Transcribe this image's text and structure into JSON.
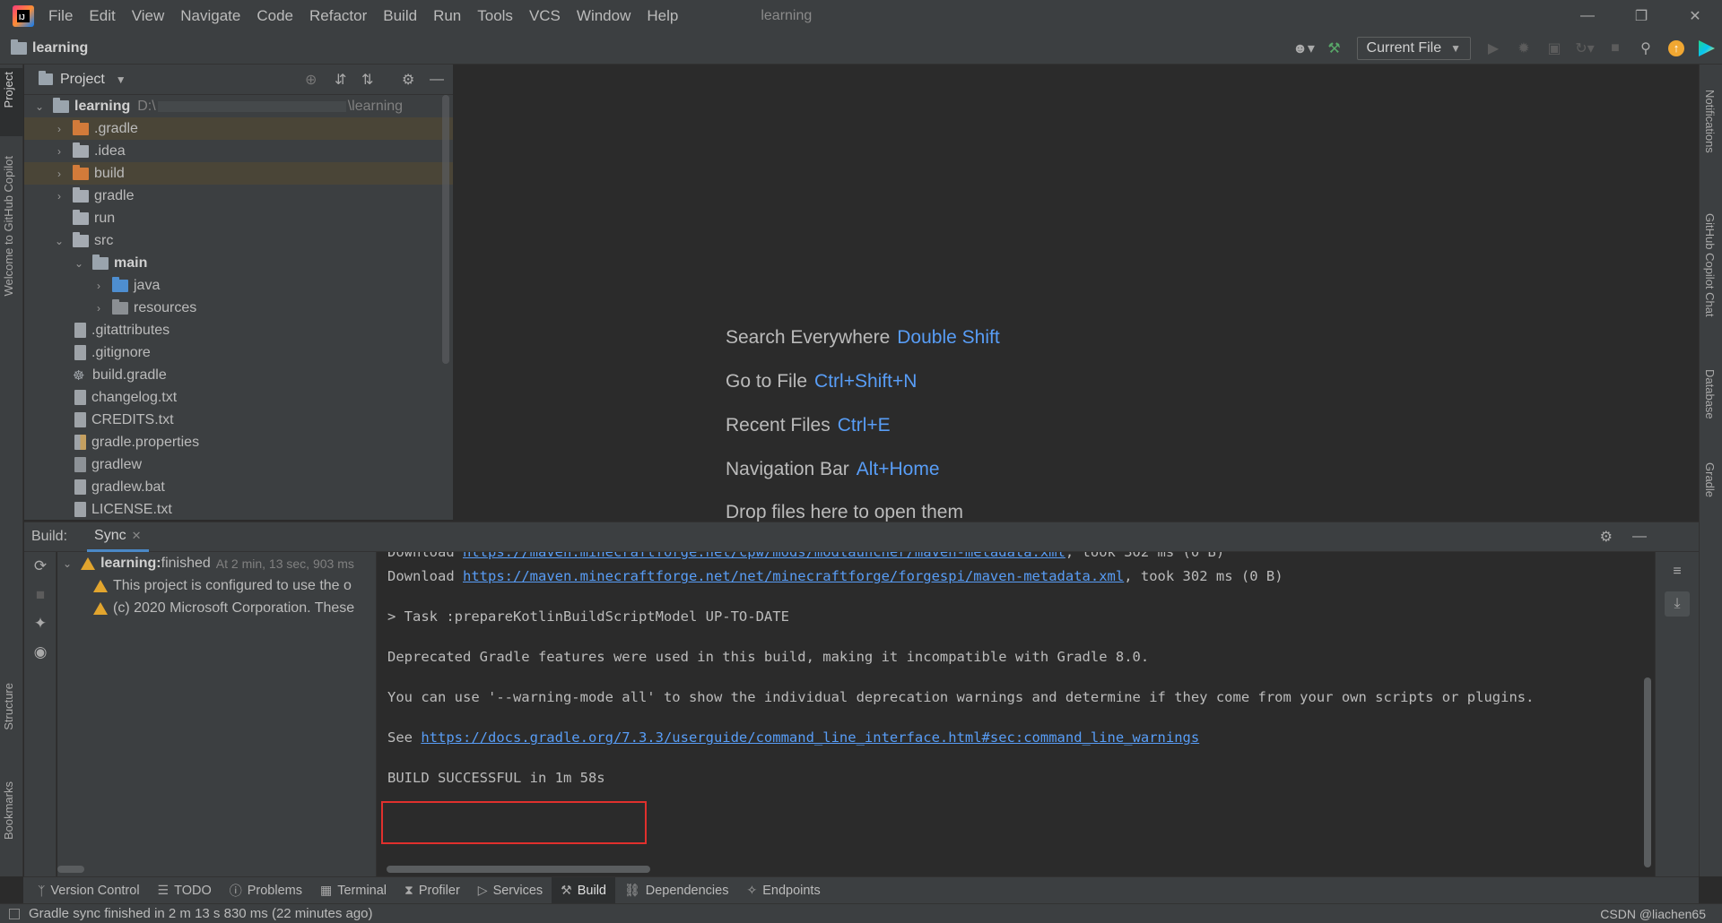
{
  "app": {
    "window_title": "learning",
    "project_name": "learning"
  },
  "menu": [
    "File",
    "Edit",
    "View",
    "Navigate",
    "Code",
    "Refactor",
    "Build",
    "Run",
    "Tools",
    "VCS",
    "Window",
    "Help"
  ],
  "toolbar": {
    "run_config": "Current File"
  },
  "left_strip": {
    "project": "Project",
    "copilot": "Welcome to GitHub Copilot",
    "structure": "Structure",
    "bookmarks": "Bookmarks"
  },
  "right_strip": {
    "notifications": "Notifications",
    "copilot_chat": "GitHub Copilot Chat",
    "database": "Database",
    "gradle": "Gradle"
  },
  "project_panel": {
    "title": "Project",
    "root_name": "learning",
    "root_path": "D:\\",
    "root_path_tail": "\\learning",
    "items": [
      {
        "label": ".gradle",
        "icon": "folder-orange"
      },
      {
        "label": ".idea",
        "icon": "folder"
      },
      {
        "label": "build",
        "icon": "folder-orange"
      },
      {
        "label": "gradle",
        "icon": "folder"
      },
      {
        "label": "run",
        "icon": "folder"
      },
      {
        "label": "src",
        "icon": "folder"
      },
      {
        "label": "main",
        "icon": "folder-module"
      },
      {
        "label": "java",
        "icon": "folder-source"
      },
      {
        "label": "resources",
        "icon": "folder-resources"
      },
      {
        "label": ".gitattributes",
        "icon": "file"
      },
      {
        "label": ".gitignore",
        "icon": "file"
      },
      {
        "label": "build.gradle",
        "icon": "gradle-file"
      },
      {
        "label": "changelog.txt",
        "icon": "file"
      },
      {
        "label": "CREDITS.txt",
        "icon": "file"
      },
      {
        "label": "gradle.properties",
        "icon": "properties-file"
      },
      {
        "label": "gradlew",
        "icon": "script-file"
      },
      {
        "label": "gradlew.bat",
        "icon": "file"
      },
      {
        "label": "LICENSE.txt",
        "icon": "file"
      }
    ]
  },
  "editor_hints": [
    {
      "text": "Search Everywhere",
      "key": "Double Shift"
    },
    {
      "text": "Go to File",
      "key": "Ctrl+Shift+N"
    },
    {
      "text": "Recent Files",
      "key": "Ctrl+E"
    },
    {
      "text": "Navigation Bar",
      "key": "Alt+Home"
    },
    {
      "text": "Drop files here to open them",
      "key": ""
    }
  ],
  "build_panel": {
    "label": "Build:",
    "tab": "Sync",
    "tree": {
      "root_name": "learning:",
      "root_status": " finished",
      "root_time": "At 2 min, 13 sec, 903 ms",
      "warnings": [
        "This project is configured to use the o",
        "(c) 2020 Microsoft Corporation. These"
      ]
    },
    "console": [
      {
        "prefix": "Download ",
        "link": "https://maven.minecraftforge.net/cpw/mods/modlauncher/maven-metadata.xml",
        "suffix": ", took 302 ms (0 B)"
      },
      {
        "prefix": "Download ",
        "link": "https://maven.minecraftforge.net/net/minecraftforge/forgespi/maven-metadata.xml",
        "suffix": ", took 302 ms (0 B)"
      },
      {
        "prefix": "> Task :prepareKotlinBuildScriptModel UP-TO-DATE",
        "link": "",
        "suffix": ""
      },
      {
        "prefix": "Deprecated Gradle features were used in this build, making it incompatible with Gradle 8.0.",
        "link": "",
        "suffix": ""
      },
      {
        "prefix": "You can use '--warning-mode all' to show the individual deprecation warnings and determine if they come from your own scripts or plugins.",
        "link": "",
        "suffix": ""
      },
      {
        "prefix": "See ",
        "link": "https://docs.gradle.org/7.3.3/userguide/command_line_interface.html#sec:command_line_warnings",
        "suffix": ""
      },
      {
        "prefix": "BUILD SUCCESSFUL in 1m 58s",
        "link": "",
        "suffix": ""
      }
    ]
  },
  "bottom_tools": [
    "Version Control",
    "TODO",
    "Problems",
    "Terminal",
    "Profiler",
    "Services",
    "Build",
    "Dependencies",
    "Endpoints"
  ],
  "status": {
    "message": "Gradle sync finished in 2 m 13 s 830 ms (22 minutes ago)",
    "watermark": "CSDN @liachen65"
  },
  "colors": {
    "accent": "#589df6",
    "highlight_box": "#e0302d",
    "warning": "#e2a52e"
  }
}
